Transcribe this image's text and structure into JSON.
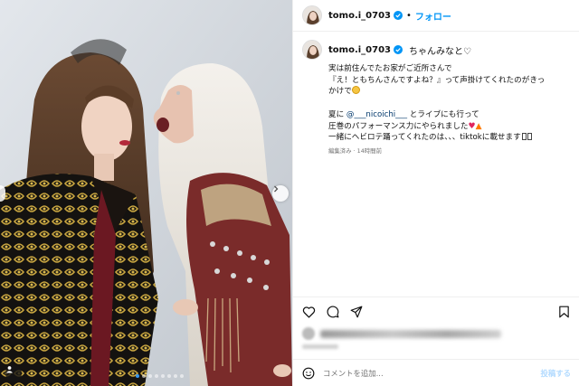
{
  "post": {
    "username": "tomo.i_0703",
    "follow_label": "フォロー",
    "caption_intro": "ちゃんみなと♡",
    "caption_lines": [
      "実は前住んでたお家がご近所さんで",
      "『え！ともちんさんですよね？』って声掛けてくれたのがきっ",
      "かけで"
    ],
    "caption_lines_2": {
      "prefix": "夏に ",
      "mention": "@___nicoichi___",
      "suffix": " とライブにも行って"
    },
    "caption_lines_3": [
      "圧巻のパフォーマンス力にやられました",
      "一緒にヘビロテ踊ってくれたのは、、、tiktokに載せます"
    ],
    "meta": "編集済み · 14時間前"
  },
  "comment": {
    "placeholder": "コメントを追加...",
    "post_label": "投稿する"
  },
  "colors": {
    "accent": "#0095f6",
    "mention": "#00376b",
    "dot_active": "#3797f0"
  },
  "icons": [
    "verified-badge-icon",
    "heart-icon",
    "comment-icon",
    "share-icon",
    "bookmark-icon",
    "emoji-icon",
    "chevron-right-icon",
    "user-tag-icon"
  ]
}
